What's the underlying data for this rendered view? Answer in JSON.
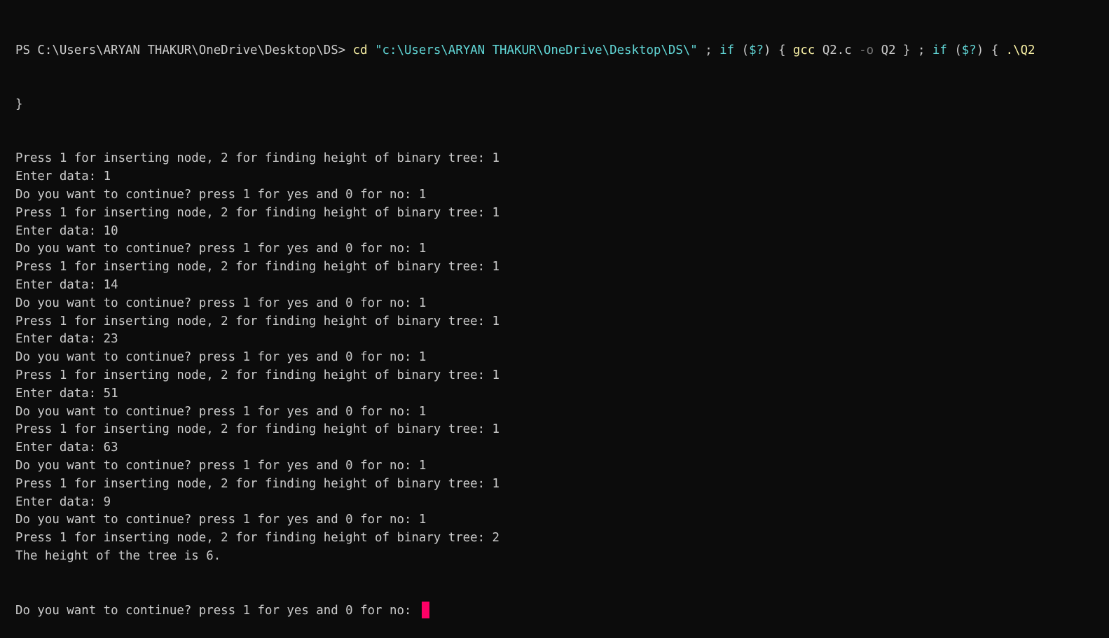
{
  "terminal": {
    "prompt": "PS C:\\Users\\ARYAN THAKUR\\OneDrive\\Desktop\\DS> ",
    "command": {
      "cd": "cd",
      "path": "\"c:\\Users\\ARYAN THAKUR\\OneDrive\\Desktop\\DS\\\"",
      "sep1": " ; ",
      "if1": "if",
      "cond1_open": " (",
      "cond1": "$?",
      "cond1_close": ") { ",
      "gcc": "gcc",
      "args1": " Q2.c ",
      "flag": "-o",
      "args2": " Q2 } ; ",
      "if2": "if",
      "cond2_open": " (",
      "cond2": "$?",
      "cond2_close": ") { ",
      "exec": ".\\Q2",
      "wrap": "}"
    },
    "output_lines": [
      "Press 1 for inserting node, 2 for finding height of binary tree: 1",
      "Enter data: 1",
      "Do you want to continue? press 1 for yes and 0 for no: 1",
      "Press 1 for inserting node, 2 for finding height of binary tree: 1",
      "Enter data: 10",
      "Do you want to continue? press 1 for yes and 0 for no: 1",
      "Press 1 for inserting node, 2 for finding height of binary tree: 1",
      "Enter data: 14",
      "Do you want to continue? press 1 for yes and 0 for no: 1",
      "Press 1 for inserting node, 2 for finding height of binary tree: 1",
      "Enter data: 23",
      "Do you want to continue? press 1 for yes and 0 for no: 1",
      "Press 1 for inserting node, 2 for finding height of binary tree: 1",
      "Enter data: 51",
      "Do you want to continue? press 1 for yes and 0 for no: 1",
      "Press 1 for inserting node, 2 for finding height of binary tree: 1",
      "Enter data: 63",
      "Do you want to continue? press 1 for yes and 0 for no: 1",
      "Press 1 for inserting node, 2 for finding height of binary tree: 1",
      "Enter data: 9",
      "Do you want to continue? press 1 for yes and 0 for no: 1",
      "Press 1 for inserting node, 2 for finding height of binary tree: 2",
      "The height of the tree is 6."
    ],
    "current_prompt": "Do you want to continue? press 1 for yes and 0 for no: ",
    "colors": {
      "background": "#0c0c0c",
      "foreground": "#cccccc",
      "command": "#f9f1a5",
      "string": "#61d6d6",
      "keyword": "#61d6d6",
      "cursor": "#ff0066"
    }
  }
}
